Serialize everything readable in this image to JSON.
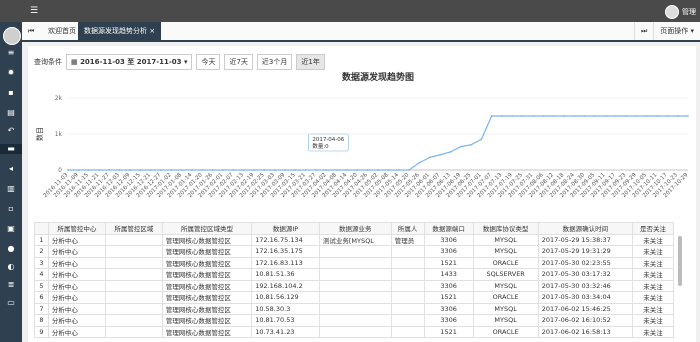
{
  "topbar": {
    "menu_icon": "hamburger-icon",
    "user_label": "管理"
  },
  "sidebar": {
    "icons": [
      "list-icon",
      "gear-icon",
      "bag-icon",
      "book-icon",
      "back-icon",
      "folder-icon",
      "megaphone-icon",
      "chart-icon",
      "chat-icon",
      "image-icon",
      "clock-icon",
      "globe-icon",
      "stack-icon",
      "desktop-icon"
    ]
  },
  "tabs": {
    "nav": "⏮",
    "home": "欢迎首页",
    "active": "数据源发现趋势分析 ×",
    "right_nav": "⏭",
    "page_ops": "页面操作 ▾"
  },
  "filter": {
    "label": "查询条件",
    "date_start": "2016-11-03",
    "to": "至",
    "date_end": "2017-11-03",
    "presets": [
      "今天",
      "近7天",
      "近3个月",
      "近1年"
    ]
  },
  "chart_data": {
    "type": "line",
    "title": "数据源发现趋势图",
    "ylabel": "数目",
    "yticks": [
      "0",
      "1k",
      "2k"
    ],
    "ylim": [
      0,
      2000
    ],
    "x": [
      "2016-11-03",
      "2016-11-09",
      "2016-11-15",
      "2016-11-21",
      "2016-11-27",
      "2016-12-03",
      "2016-12-09",
      "2016-12-15",
      "2016-12-21",
      "2016-12-27",
      "2017-01-02",
      "2017-01-08",
      "2017-01-14",
      "2017-01-20",
      "2017-01-26",
      "2017-02-01",
      "2017-02-07",
      "2017-02-13",
      "2017-02-19",
      "2017-02-25",
      "2017-03-03",
      "2017-03-09",
      "2017-03-15",
      "2017-03-21",
      "2017-03-27",
      "2017-04-02",
      "2017-04-08",
      "2017-04-14",
      "2017-04-20",
      "2017-04-26",
      "2017-05-02",
      "2017-05-08",
      "2017-05-14",
      "2017-05-20",
      "2017-05-26",
      "2017-06-01",
      "2017-06-07",
      "2017-06-13",
      "2017-06-19",
      "2017-06-25",
      "2017-07-01",
      "2017-07-07",
      "2017-07-13",
      "2017-07-19",
      "2017-07-25",
      "2017-07-31",
      "2017-08-06",
      "2017-08-12",
      "2017-08-18",
      "2017-08-24",
      "2017-08-30",
      "2017-09-05",
      "2017-09-11",
      "2017-09-17",
      "2017-09-23",
      "2017-09-29",
      "2017-10-05",
      "2017-10-11",
      "2017-10-17",
      "2017-10-23",
      "2017-10-29"
    ],
    "values": [
      0,
      0,
      0,
      0,
      0,
      0,
      0,
      0,
      0,
      0,
      0,
      0,
      0,
      0,
      0,
      0,
      0,
      0,
      0,
      0,
      0,
      0,
      0,
      0,
      0,
      0,
      0,
      0,
      0,
      0,
      0,
      0,
      0,
      0,
      200,
      350,
      420,
      500,
      650,
      700,
      850,
      1500,
      1500,
      1500,
      1500,
      1500,
      1500,
      1500,
      1500,
      1500,
      1500,
      1500,
      1500,
      1500,
      1500,
      1500,
      1500,
      1500,
      1500,
      1500,
      1500
    ],
    "tooltip": {
      "date": "2017-04-06",
      "value_label": "数量:0"
    }
  },
  "table": {
    "headers": [
      "",
      "所属管控中心",
      "所属管控区域",
      "所属管控区域类型",
      "数据源IP",
      "数据源业务",
      "所属人",
      "数据源端口",
      "数据库协议类型",
      "数据源确认时间",
      "是否关注"
    ],
    "rows": [
      [
        "1",
        "分析中心",
        "",
        "管理网核心数据管控区",
        "172.16.75.134",
        "测试业务[MYSQL",
        "管理员",
        "3306",
        "MYSQL",
        "2017-05-29 15:38:37",
        "未关注"
      ],
      [
        "2",
        "分析中心",
        "",
        "管理网核心数据管控区",
        "172.16.35.175",
        "",
        "",
        "3306",
        "MYSQL",
        "2017-05-29 19:31:29",
        "未关注"
      ],
      [
        "3",
        "分析中心",
        "",
        "管理网核心数据管控区",
        "172.16.83.113",
        "",
        "",
        "1521",
        "ORACLE",
        "2017-05-30 02:23:55",
        "未关注"
      ],
      [
        "4",
        "分析中心",
        "",
        "管理网核心数据管控区",
        "10.81.51.36",
        "",
        "",
        "1433",
        "SQLSERVER",
        "2017-05-30 03:17:32",
        "未关注"
      ],
      [
        "5",
        "分析中心",
        "",
        "管理网核心数据管控区",
        "192.168.104.2",
        "",
        "",
        "3306",
        "MYSQL",
        "2017-05-30 03:32:46",
        "未关注"
      ],
      [
        "6",
        "分析中心",
        "",
        "管理网核心数据管控区",
        "10.81.56.129",
        "",
        "",
        "1521",
        "ORACLE",
        "2017-05-30 03:34:04",
        "未关注"
      ],
      [
        "7",
        "分析中心",
        "",
        "管理网核心数据管控区",
        "10.58.30.3",
        "",
        "",
        "3306",
        "MYSQL",
        "2017-06-02 15:46:25",
        "未关注"
      ],
      [
        "8",
        "分析中心",
        "",
        "管理网核心数据管控区",
        "10.81.70.53",
        "",
        "",
        "3306",
        "MYSQL",
        "2017-06-02 16:10:52",
        "未关注"
      ],
      [
        "9",
        "分析中心",
        "",
        "管理网核心数据管控区",
        "10.73.41.23",
        "",
        "",
        "1521",
        "ORACLE",
        "2017-06-02 16:58:13",
        "未关注"
      ]
    ]
  }
}
